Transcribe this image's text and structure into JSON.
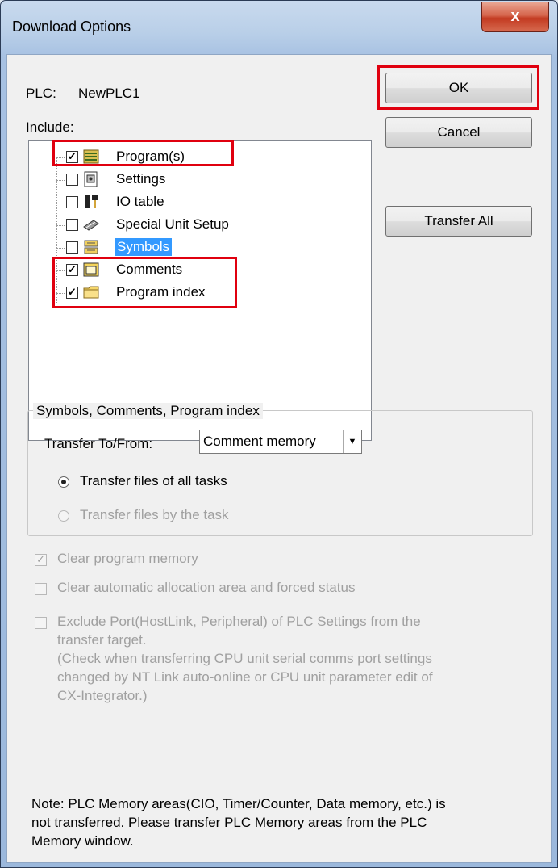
{
  "window": {
    "title": "Download Options",
    "close_label": "x"
  },
  "plc": {
    "label": "PLC:",
    "name": "NewPLC1"
  },
  "include_label": "Include:",
  "buttons": {
    "ok": "OK",
    "cancel": "Cancel",
    "transfer_all": "Transfer All"
  },
  "tree": {
    "items": [
      {
        "label": "Program(s)",
        "checked": true,
        "icon": "program-icon"
      },
      {
        "label": "Settings",
        "checked": false,
        "icon": "settings-icon"
      },
      {
        "label": "IO table",
        "checked": false,
        "icon": "io-table-icon"
      },
      {
        "label": "Special Unit Setup",
        "checked": false,
        "icon": "special-unit-icon"
      },
      {
        "label": "Symbols",
        "checked": false,
        "icon": "symbols-icon",
        "selected": true
      },
      {
        "label": "Comments",
        "checked": true,
        "icon": "comments-icon"
      },
      {
        "label": "Program index",
        "checked": true,
        "icon": "folder-icon"
      }
    ]
  },
  "group": {
    "title": "Symbols, Comments, Program index",
    "transfer_label": "Transfer To/From:",
    "transfer_value": "Comment memory",
    "radio_all": "Transfer files of all tasks",
    "radio_task": "Transfer files by the task"
  },
  "options": {
    "clear_program": "Clear program memory",
    "clear_auto": "Clear automatic allocation area and forced status",
    "exclude_port": "Exclude Port(HostLink, Peripheral) of PLC Settings from the",
    "exclude_port_2": "transfer target.",
    "exclude_note_1": "(Check when transferring CPU unit serial comms port settings",
    "exclude_note_2": "changed by NT Link auto-online or CPU unit parameter edit of",
    "exclude_note_3": "CX-Integrator.)"
  },
  "note": {
    "line1": "Note: PLC Memory areas(CIO, Timer/Counter, Data memory, etc.) is",
    "line2": "not transferred. Please transfer PLC Memory areas from the PLC",
    "line3": "Memory window."
  },
  "colors": {
    "highlight": "#e0000f",
    "selection": "#3399ff"
  }
}
